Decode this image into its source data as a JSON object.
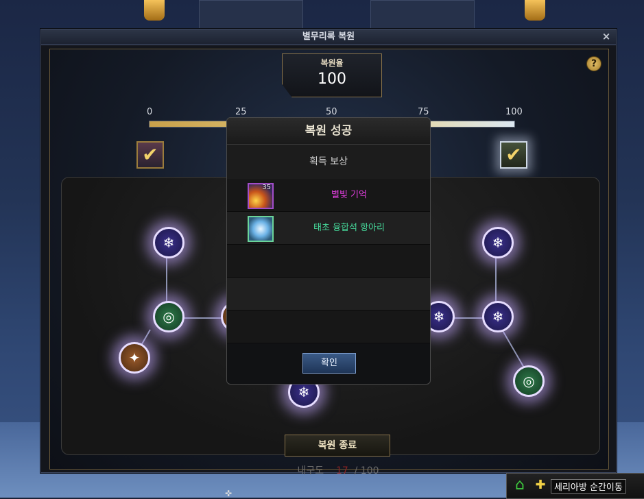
{
  "window": {
    "title": "별무리록 복원",
    "close_glyph": "×",
    "help_glyph": "?"
  },
  "restore": {
    "rate_label": "복원율",
    "rate_value": "100",
    "progress_fraction": 1.0,
    "ticks": [
      "0",
      "25",
      "50",
      "75",
      "100"
    ]
  },
  "end_button_label": "복원 종료",
  "durability": {
    "label": "내구도",
    "current": "17",
    "max": "/ 100"
  },
  "modal": {
    "title": "복원 성공",
    "reward_header": "획득 보상",
    "items": [
      {
        "name": "별빛 기억",
        "count": "35",
        "color": "#e33fe0",
        "icon": "star-memory-icon"
      },
      {
        "name": "태초 융합석 항아리",
        "count": "",
        "color": "#46d89a",
        "icon": "fusion-jar-icon"
      }
    ],
    "confirm_label": "확인"
  },
  "quickbar": {
    "teleport_label": "세리아방 순간이동"
  }
}
